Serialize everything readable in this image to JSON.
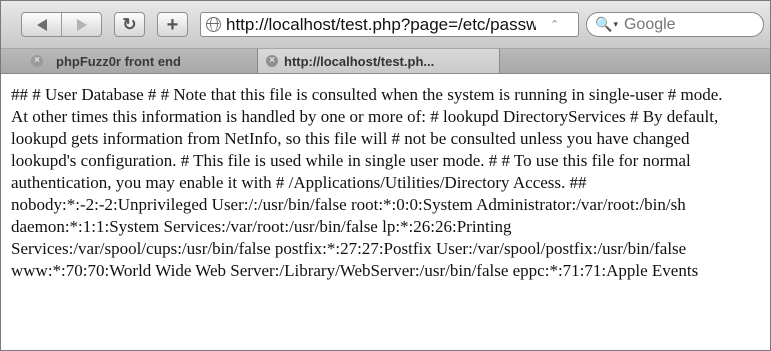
{
  "toolbar": {
    "back_icon": "back-arrow-icon",
    "forward_icon": "forward-arrow-icon",
    "reload_icon": "reload-icon",
    "add_icon": "plus-icon",
    "reload_glyph": "↻",
    "add_glyph": "+",
    "address": {
      "url": "http://localhost/test.php?page=/etc/passwd"
    },
    "search": {
      "placeholder": "Google",
      "icon_glyph": "🔍",
      "caret_glyph": "▾"
    }
  },
  "tabs": [
    {
      "label": "phpFuzz0r front end",
      "close_glyph": "×"
    },
    {
      "label": "http://localhost/test.ph...",
      "close_glyph": "×"
    }
  ],
  "content": {
    "text": "## # User Database # # Note that this file is consulted when the system is running in single-user # mode. At other times this information is handled by one or more of: # lookupd DirectoryServices # By default, lookupd gets information from NetInfo, so this file will # not be consulted unless you have changed lookupd's configuration. # This file is used while in single user mode. # # To use this file for normal authentication, you may enable it with # /Applications/Utilities/Directory Access. ## nobody:*:-2:-2:Unprivileged User:/:/usr/bin/false root:*:0:0:System Administrator:/var/root:/bin/sh daemon:*:1:1:System Services:/var/root:/usr/bin/false lp:*:26:26:Printing Services:/var/spool/cups:/usr/bin/false postfix:*:27:27:Postfix User:/var/spool/postfix:/usr/bin/false www:*:70:70:World Wide Web Server:/Library/WebServer:/usr/bin/false eppc:*:71:71:Apple Events"
  }
}
